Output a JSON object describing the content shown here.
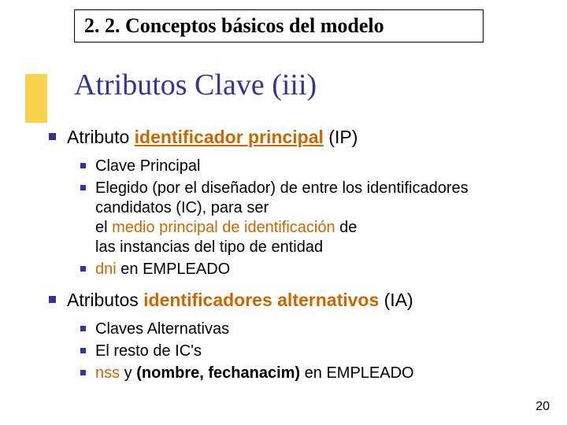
{
  "header": {
    "title": "2. 2. Conceptos básicos del modelo"
  },
  "title": "Atributos Clave (iii)",
  "sections": [
    {
      "labelPrefix": "Atributo ",
      "labelEmph": "identificador principal",
      "labelSuffix": " (IP)",
      "items": [
        {
          "plain": "Clave Principal"
        },
        {
          "t1": "Elegido (por el diseñador) de entre los identificadores candidatos (IC), para ser",
          "t2a": "el ",
          "t2emph": "medio principal de identificación",
          "t2b": " de",
          "t3": "las instancias del tipo de entidad"
        },
        {
          "emph": "dni",
          "rest": " en EMPLEADO"
        }
      ]
    },
    {
      "labelPrefix": "Atributos ",
      "labelEmph": "identificadores alternativos",
      "labelSuffix": " (IA)",
      "items": [
        {
          "plain": "Claves Alternativas"
        },
        {
          "plain": "El resto de IC's"
        },
        {
          "emph": "nss",
          "mid": " y ",
          "bold": "(nombre, fechanacim)",
          "rest": " en EMPLEADO"
        }
      ]
    }
  ],
  "slideNumber": "20"
}
